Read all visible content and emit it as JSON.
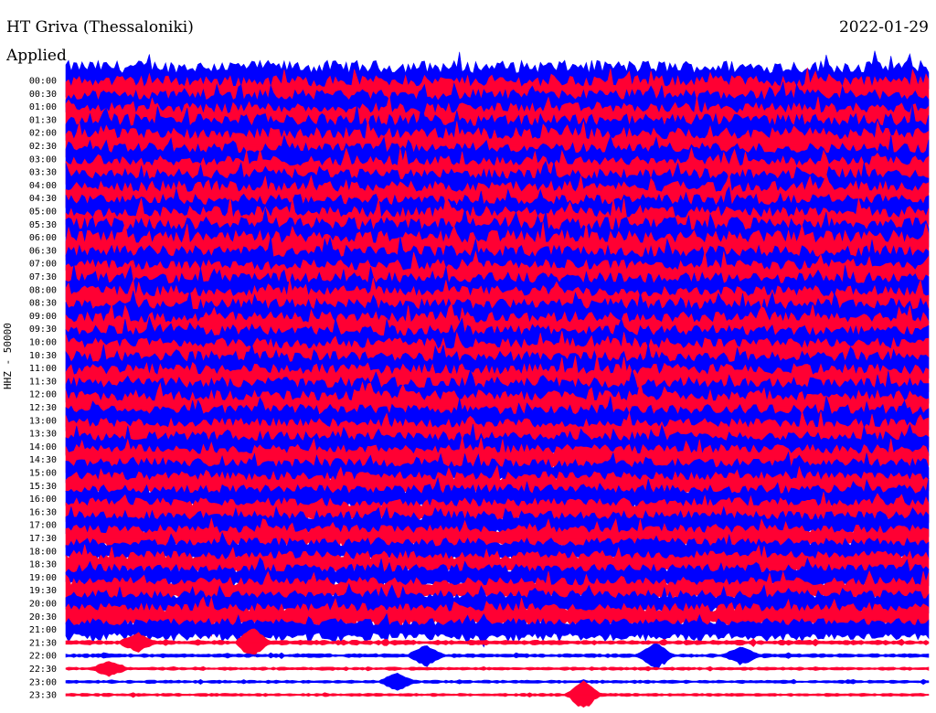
{
  "header": {
    "station": "HT Griva (Thessaloniki)",
    "date": "2022-01-29",
    "filter": "Applied",
    "channel": "HHZ - 50000"
  },
  "chart_data": {
    "type": "line",
    "title": "HT Griva (Thessaloniki)",
    "subtitle": "2022-01-29",
    "ylabel": "HHZ - 50000",
    "colors": [
      "#0000ff",
      "#ff0033"
    ],
    "rows": [
      {
        "time": "00:00",
        "amplitude": 1.0
      },
      {
        "time": "00:30",
        "amplitude": 0.9
      },
      {
        "time": "01:00",
        "amplitude": 0.85
      },
      {
        "time": "01:30",
        "amplitude": 0.85
      },
      {
        "time": "02:00",
        "amplitude": 0.95
      },
      {
        "time": "02:30",
        "amplitude": 0.9
      },
      {
        "time": "03:00",
        "amplitude": 0.8
      },
      {
        "time": "03:30",
        "amplitude": 0.8
      },
      {
        "time": "04:00",
        "amplitude": 0.8
      },
      {
        "time": "04:30",
        "amplitude": 0.85
      },
      {
        "time": "05:00",
        "amplitude": 0.85
      },
      {
        "time": "05:30",
        "amplitude": 0.9
      },
      {
        "time": "06:00",
        "amplitude": 1.0
      },
      {
        "time": "06:30",
        "amplitude": 1.0
      },
      {
        "time": "07:00",
        "amplitude": 0.9
      },
      {
        "time": "07:30",
        "amplitude": 0.85
      },
      {
        "time": "08:00",
        "amplitude": 0.85
      },
      {
        "time": "08:30",
        "amplitude": 0.85
      },
      {
        "time": "09:00",
        "amplitude": 0.85
      },
      {
        "time": "09:30",
        "amplitude": 0.85
      },
      {
        "time": "10:00",
        "amplitude": 0.85
      },
      {
        "time": "10:30",
        "amplitude": 0.85
      },
      {
        "time": "11:00",
        "amplitude": 0.85
      },
      {
        "time": "11:30",
        "amplitude": 0.85
      },
      {
        "time": "12:00",
        "amplitude": 0.85
      },
      {
        "time": "12:30",
        "amplitude": 0.85
      },
      {
        "time": "13:00",
        "amplitude": 0.8
      },
      {
        "time": "13:30",
        "amplitude": 0.75
      },
      {
        "time": "14:00",
        "amplitude": 0.75
      },
      {
        "time": "14:30",
        "amplitude": 0.75
      },
      {
        "time": "15:00",
        "amplitude": 0.7
      },
      {
        "time": "15:30",
        "amplitude": 0.7
      },
      {
        "time": "16:00",
        "amplitude": 0.7
      },
      {
        "time": "16:30",
        "amplitude": 0.7
      },
      {
        "time": "17:00",
        "amplitude": 0.7
      },
      {
        "time": "17:30",
        "amplitude": 0.65
      },
      {
        "time": "18:00",
        "amplitude": 0.65
      },
      {
        "time": "18:30",
        "amplitude": 0.65
      },
      {
        "time": "19:00",
        "amplitude": 0.65
      },
      {
        "time": "19:30",
        "amplitude": 0.65
      },
      {
        "time": "20:00",
        "amplitude": 0.65
      },
      {
        "time": "20:30",
        "amplitude": 0.65
      },
      {
        "time": "21:00",
        "amplitude": 0.55
      },
      {
        "time": "21:30",
        "amplitude": 0.12
      },
      {
        "time": "22:00",
        "amplitude": 0.1
      },
      {
        "time": "22:30",
        "amplitude": 0.08
      },
      {
        "time": "23:00",
        "amplitude": 0.08
      },
      {
        "time": "23:30",
        "amplitude": 0.08
      }
    ],
    "events": [
      {
        "time": "21:30",
        "minute": 2.5,
        "size": 0.6
      },
      {
        "time": "21:30",
        "minute": 6.5,
        "size": 1.0
      },
      {
        "time": "22:00",
        "minute": 12.5,
        "size": 0.7
      },
      {
        "time": "22:00",
        "minute": 20.5,
        "size": 0.9
      },
      {
        "time": "22:00",
        "minute": 23.5,
        "size": 0.6
      },
      {
        "time": "22:30",
        "minute": 1.5,
        "size": 0.5
      },
      {
        "time": "23:00",
        "minute": 11.5,
        "size": 0.6
      },
      {
        "time": "23:30",
        "minute": 18.0,
        "size": 1.0
      }
    ]
  }
}
